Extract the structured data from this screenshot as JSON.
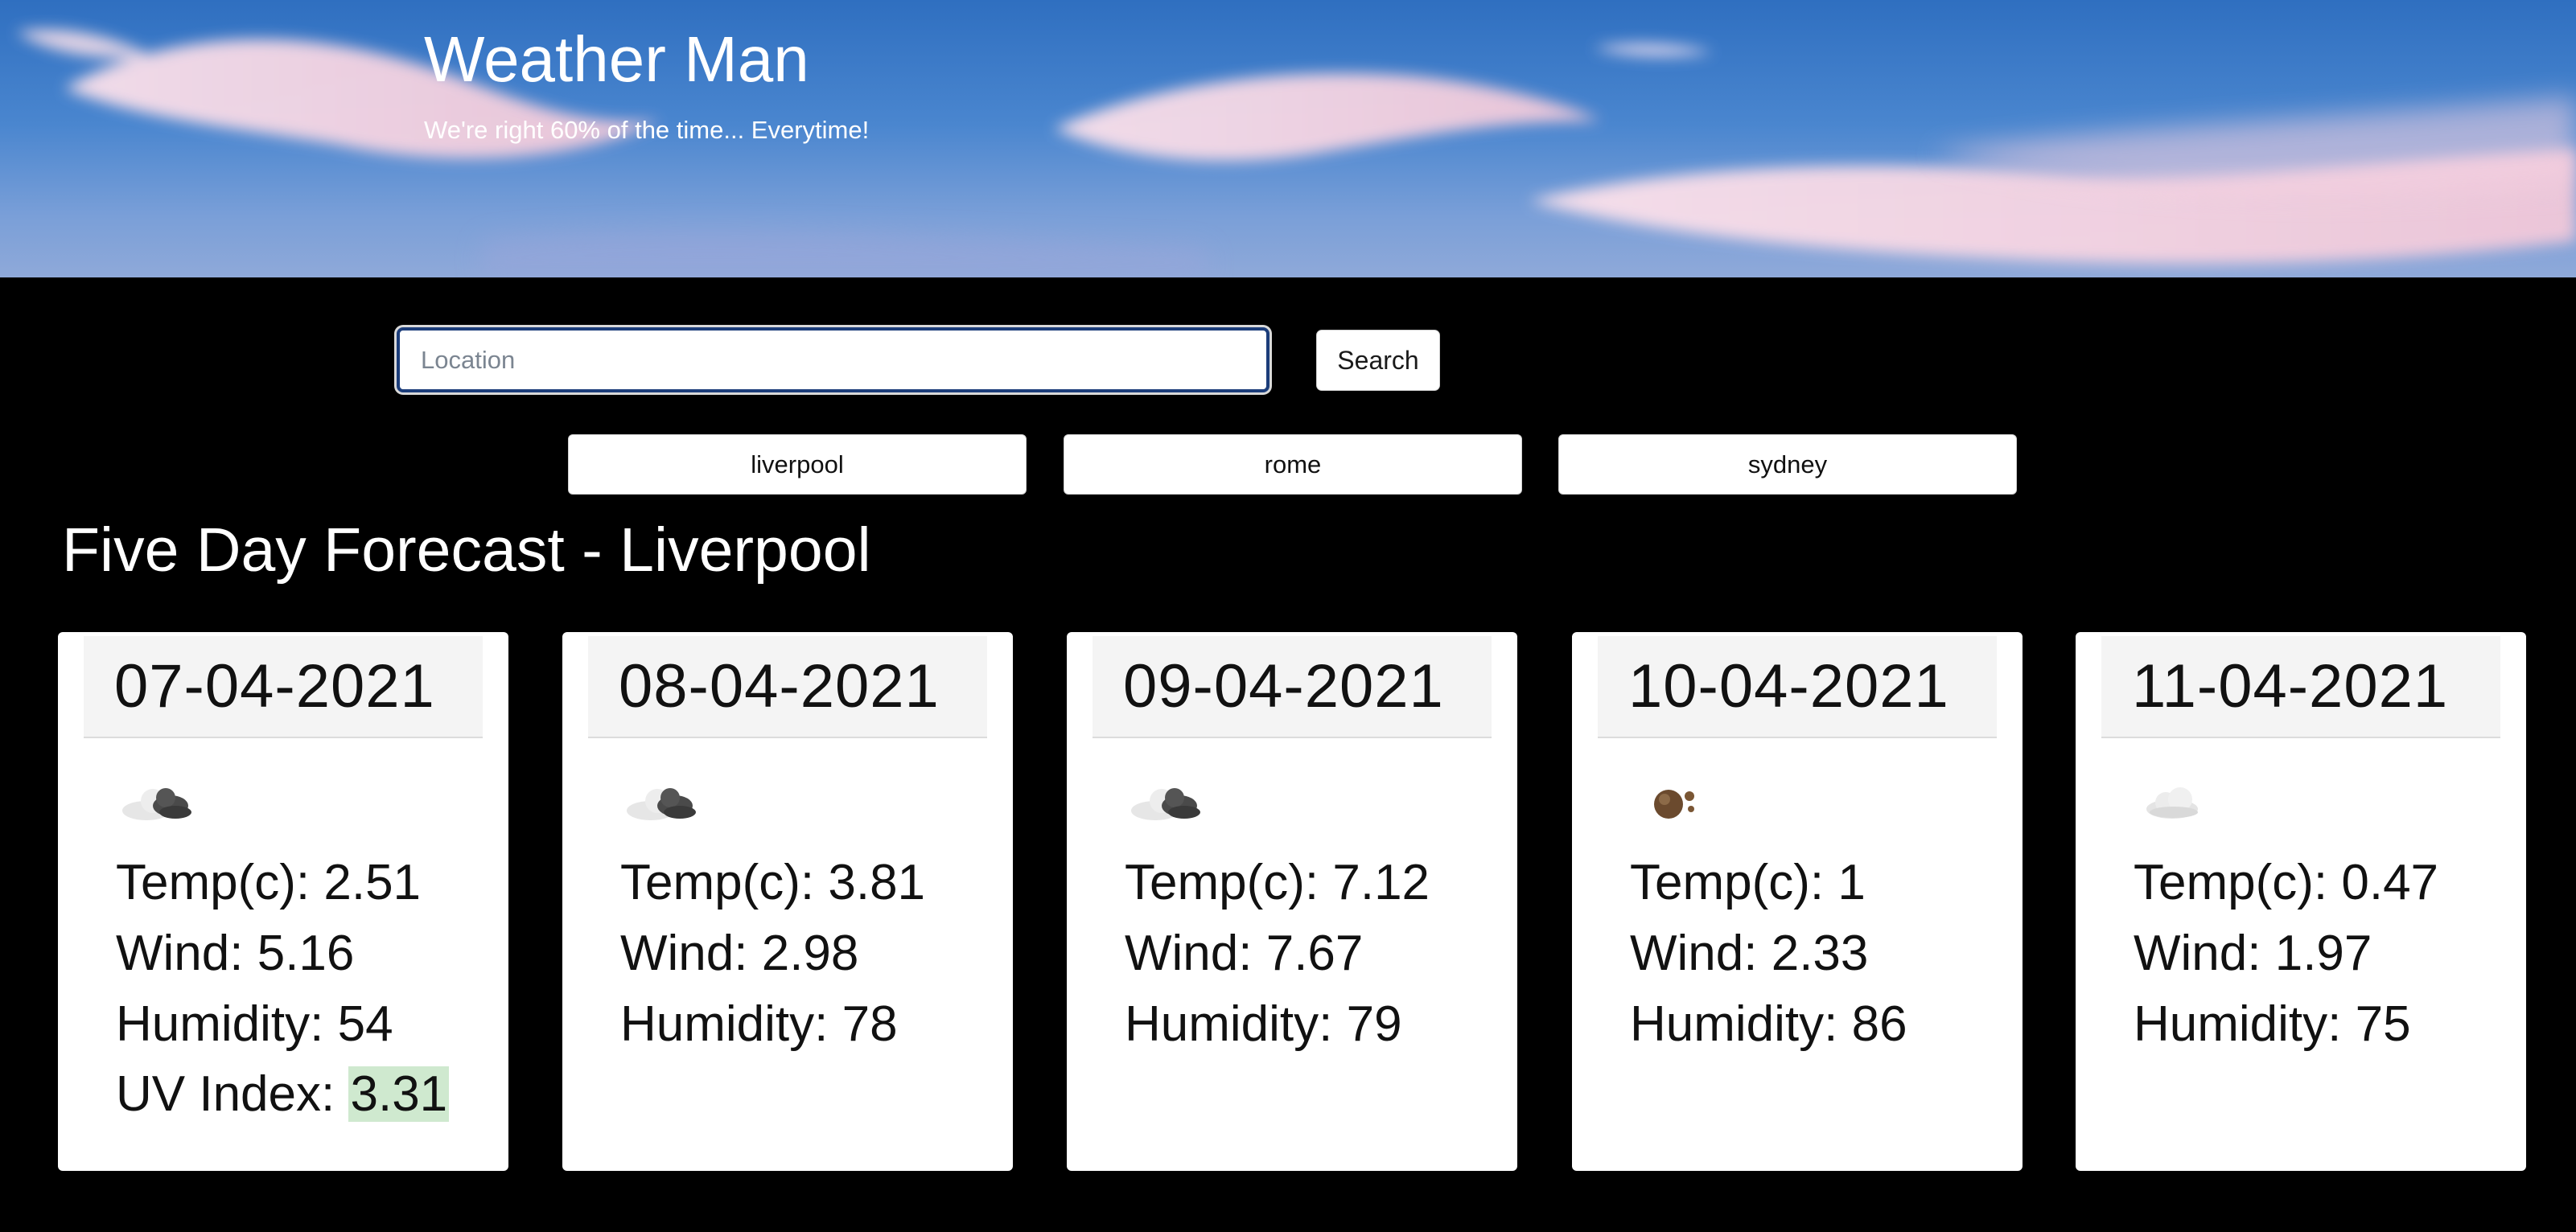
{
  "header": {
    "title": "Weather Man",
    "tagline": "We're right 60% of the time... Everytime!"
  },
  "search": {
    "placeholder": "Location",
    "value": "",
    "button_label": "Search"
  },
  "history": [
    {
      "label": "liverpool"
    },
    {
      "label": "rome"
    },
    {
      "label": "sydney"
    }
  ],
  "forecast": {
    "heading": "Five Day Forecast - Liverpool",
    "days": [
      {
        "date": "07-04-2021",
        "icon": "partly-cloudy-icon",
        "temp_label": "Temp(c): ",
        "temp": "2.51",
        "wind_label": "Wind: ",
        "wind": "5.16",
        "humidity_label": "Humidity: ",
        "humidity": "54",
        "uv_label": "UV Index: ",
        "uv": "3.31"
      },
      {
        "date": "08-04-2021",
        "icon": "partly-cloudy-icon",
        "temp_label": "Temp(c): ",
        "temp": "3.81",
        "wind_label": "Wind: ",
        "wind": "2.98",
        "humidity_label": "Humidity: ",
        "humidity": "78"
      },
      {
        "date": "09-04-2021",
        "icon": "partly-cloudy-icon",
        "temp_label": "Temp(c): ",
        "temp": "7.12",
        "wind_label": "Wind: ",
        "wind": "7.67",
        "humidity_label": "Humidity: ",
        "humidity": "79"
      },
      {
        "date": "10-04-2021",
        "icon": "hail-icon",
        "temp_label": "Temp(c): ",
        "temp": "1",
        "wind_label": "Wind: ",
        "wind": "2.33",
        "humidity_label": "Humidity: ",
        "humidity": "86"
      },
      {
        "date": "11-04-2021",
        "icon": "cloud-icon",
        "temp_label": "Temp(c): ",
        "temp": "0.47",
        "wind_label": "Wind: ",
        "wind": "1.97",
        "humidity_label": "Humidity: ",
        "humidity": "75"
      }
    ]
  },
  "colors": {
    "page_background": "#000000",
    "uv_badge": "#cfe9cf",
    "input_focus_border": "#1c3d7a"
  }
}
